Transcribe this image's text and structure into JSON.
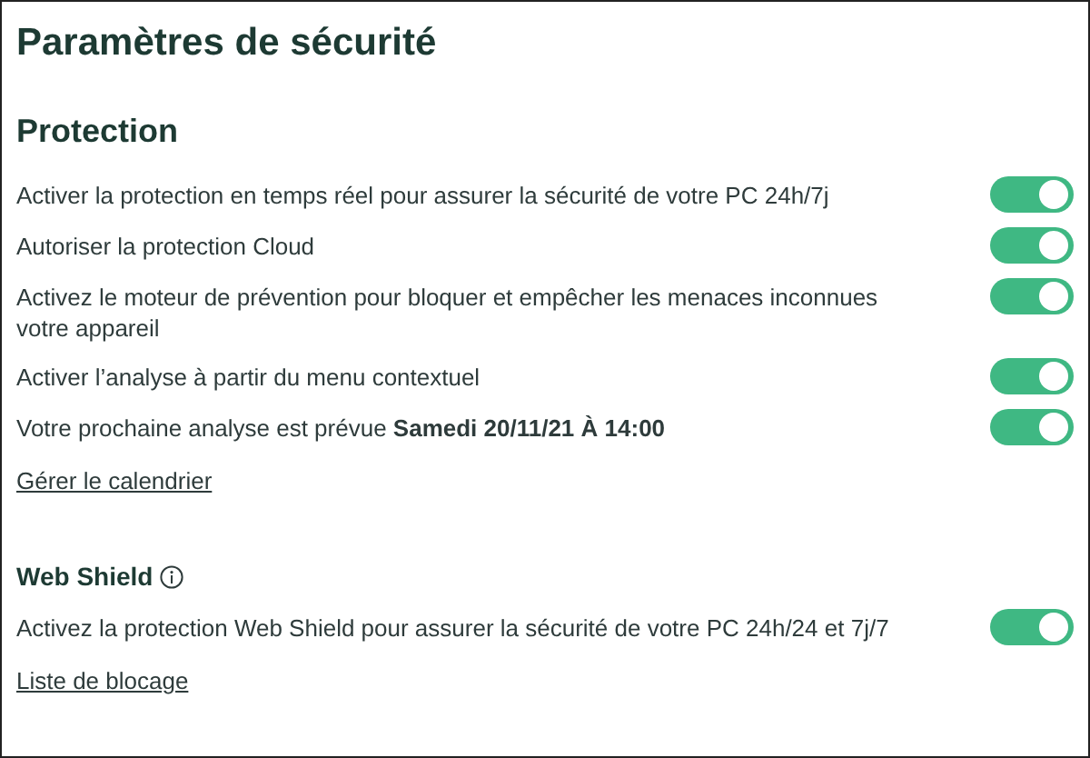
{
  "title": "Paramètres de sécurité",
  "sections": [
    {
      "kind": "heading",
      "title": "Protection",
      "info": false,
      "items": [
        {
          "kind": "toggle",
          "label": "Activer la protection en temps réel pour assurer la sécurité de votre PC 24h/7j",
          "on": true
        },
        {
          "kind": "toggle",
          "label": "Autoriser la protection Cloud",
          "on": true
        },
        {
          "kind": "toggle",
          "label": "Activez le moteur de prévention pour bloquer et empêcher les menaces inconnues votre appareil",
          "on": true
        },
        {
          "kind": "toggle",
          "label": "Activer l’analyse à partir du menu contextuel",
          "on": true
        },
        {
          "kind": "toggle",
          "label": "Votre prochaine analyse est prévue **Samedi 20/11/21 À 14:00**",
          "on": true
        },
        {
          "kind": "link",
          "label": "Gérer le calendrier"
        }
      ]
    },
    {
      "kind": "subheading",
      "title": "Web Shield",
      "info": true,
      "items": [
        {
          "kind": "toggle",
          "label": "Activez la protection Web Shield pour assurer la sécurité de votre PC 24h/24 et 7j/7",
          "on": true
        },
        {
          "kind": "link",
          "label": "Liste de blocage"
        }
      ]
    }
  ]
}
